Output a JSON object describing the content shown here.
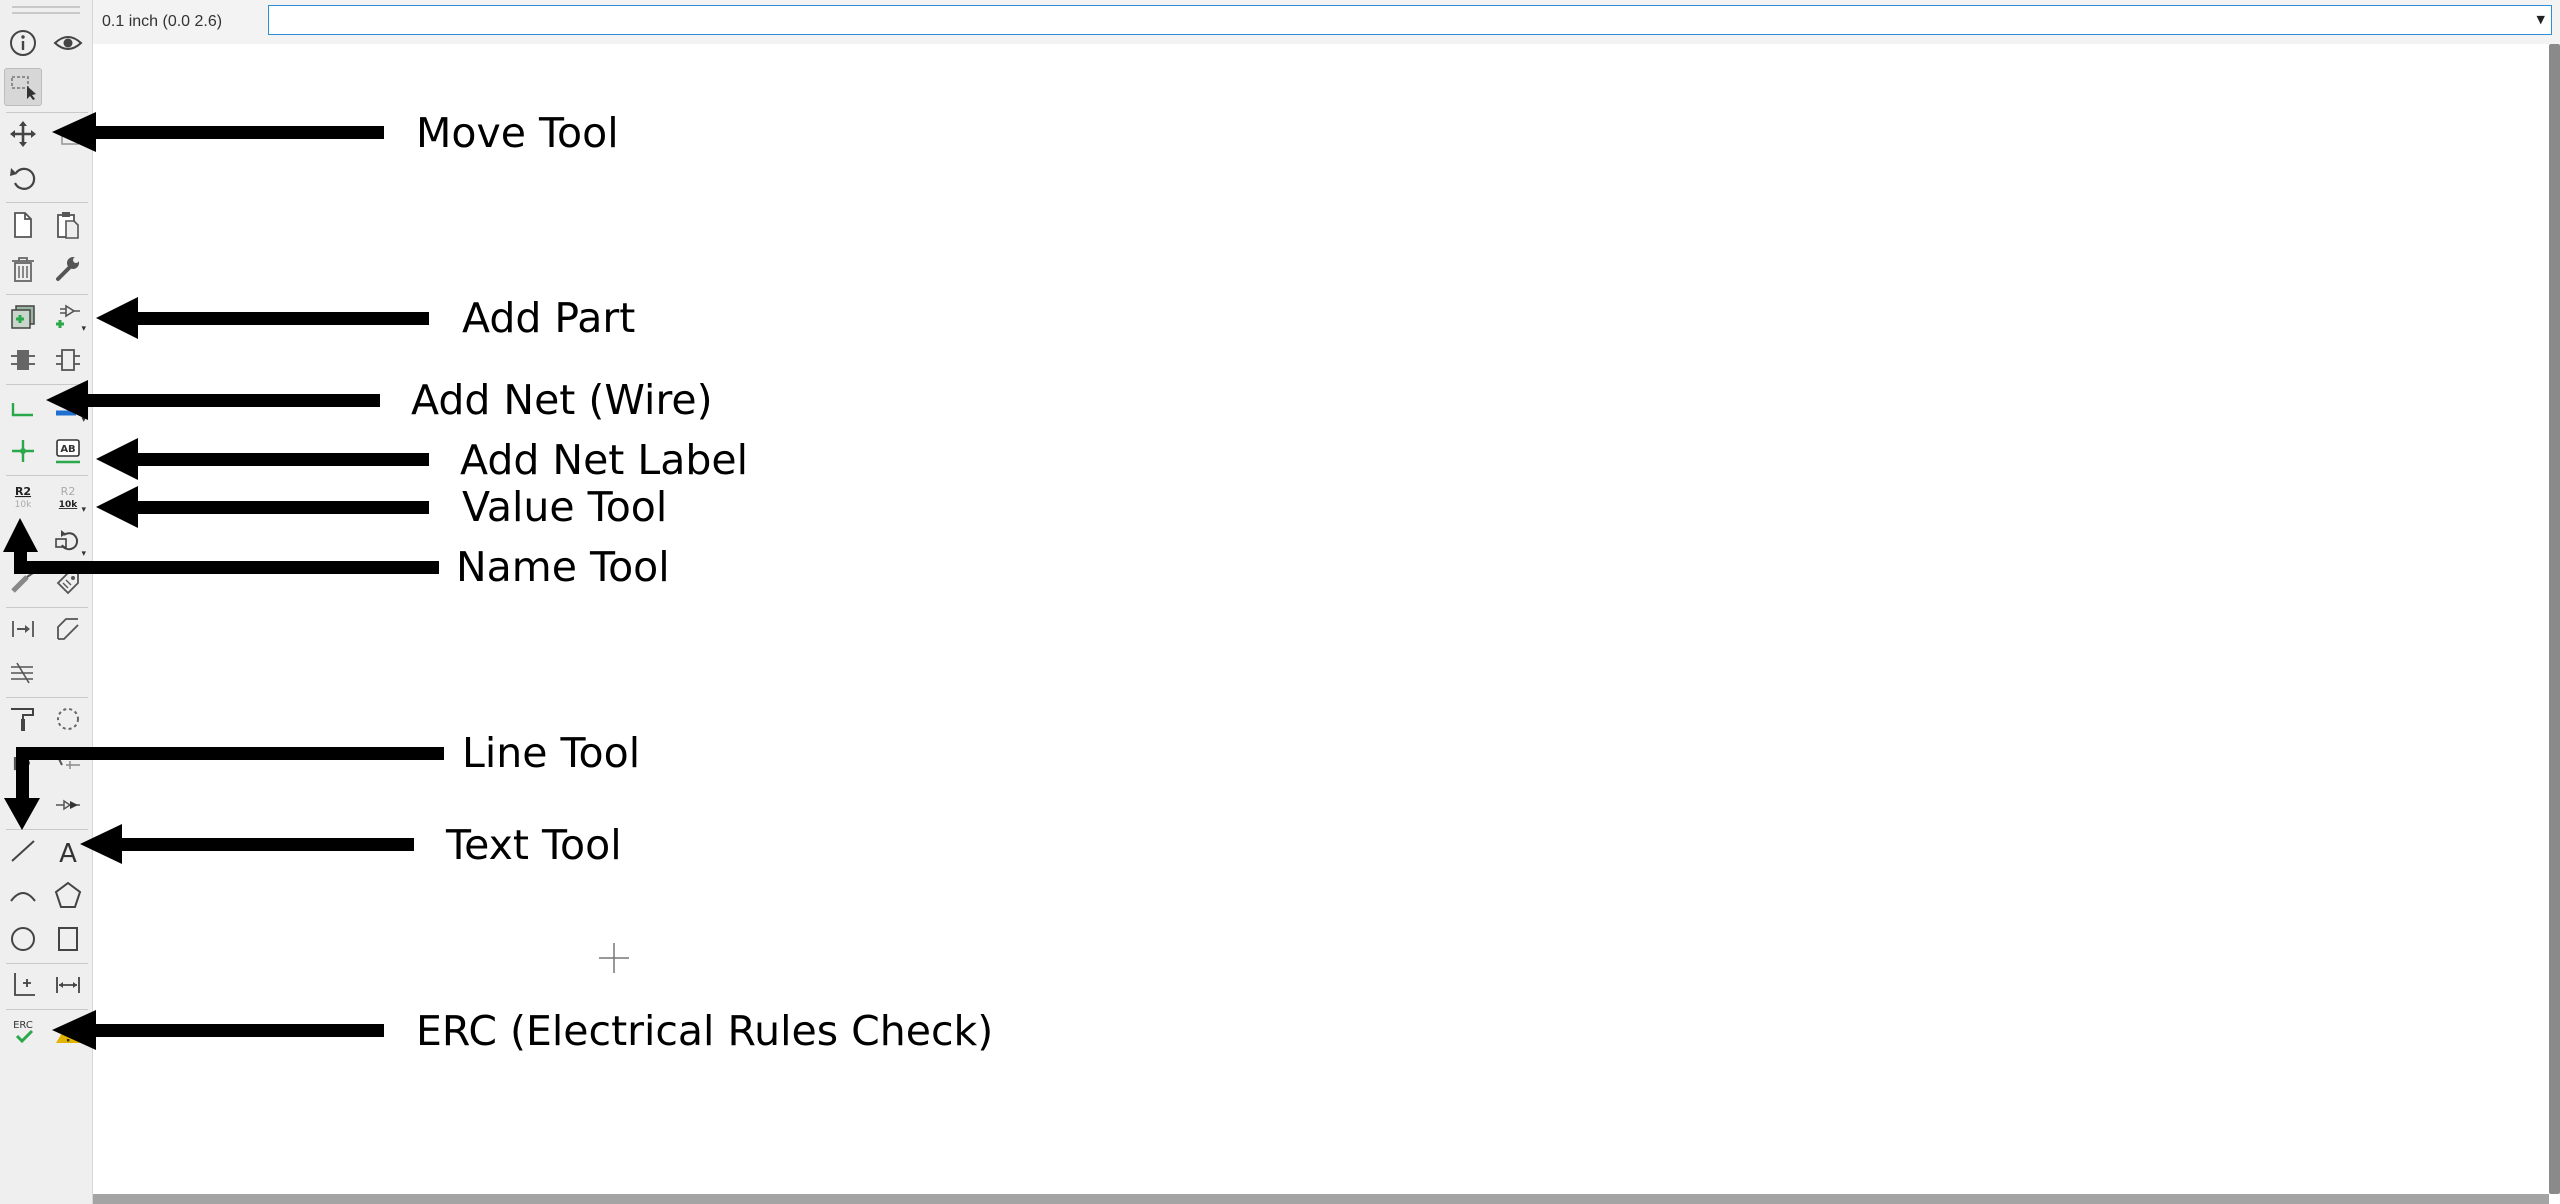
{
  "topbar": {
    "grid_label": "0.1 inch (0.0 2.6)",
    "command_value": ""
  },
  "toolbar": {
    "tools": [
      {
        "name": "info-icon"
      },
      {
        "name": "eye-icon"
      },
      {
        "name": "select-icon"
      },
      {
        "name": "move-icon"
      },
      {
        "name": "copy-group-icon"
      },
      {
        "name": "rotate-icon"
      },
      {
        "name": "copy-icon"
      },
      {
        "name": "paste-icon"
      },
      {
        "name": "delete-icon"
      },
      {
        "name": "wrench-icon"
      },
      {
        "name": "add-part-icon"
      },
      {
        "name": "add-symbol-icon"
      },
      {
        "name": "pinswap-icon"
      },
      {
        "name": "gate-icon"
      },
      {
        "name": "wire-icon"
      },
      {
        "name": "bus-icon"
      },
      {
        "name": "junction-icon"
      },
      {
        "name": "net-label-icon"
      },
      {
        "name": "name-icon"
      },
      {
        "name": "value-icon"
      },
      {
        "name": "smash-icon"
      },
      {
        "name": "mirror-icon"
      },
      {
        "name": "split-icon"
      },
      {
        "name": "attribute-icon"
      },
      {
        "name": "invoke-icon"
      },
      {
        "name": "miter-icon"
      },
      {
        "name": "optimize-icon"
      },
      {
        "name": "paint-icon"
      },
      {
        "name": "group-icon"
      },
      {
        "name": "route-icon"
      },
      {
        "name": "ripup-icon"
      },
      {
        "name": "line-icon"
      },
      {
        "name": "text-icon"
      },
      {
        "name": "arc-icon"
      },
      {
        "name": "polygon-icon"
      },
      {
        "name": "circle-icon"
      },
      {
        "name": "rectangle-icon"
      },
      {
        "name": "dimension-icon"
      },
      {
        "name": "measure-icon"
      },
      {
        "name": "erc-icon"
      },
      {
        "name": "warning-icon"
      }
    ],
    "erc_text": "ERC",
    "name_text": "R2",
    "name_sub": "10k",
    "value_text": "R2",
    "value_sub": "10k",
    "net_label_text": "AB",
    "text_glyph": "A"
  },
  "annotations": [
    {
      "id": "move",
      "text": "Move Tool"
    },
    {
      "id": "add_part",
      "text": "Add Part"
    },
    {
      "id": "add_net",
      "text": "Add Net (Wire)"
    },
    {
      "id": "add_net_label",
      "text": "Add Net Label"
    },
    {
      "id": "value",
      "text": "Value Tool"
    },
    {
      "id": "name",
      "text": "Name Tool"
    },
    {
      "id": "line",
      "text": "Line Tool"
    },
    {
      "id": "text",
      "text": "Text Tool"
    },
    {
      "id": "erc",
      "text": "ERC (Electrical Rules Check)"
    }
  ],
  "colors": {
    "accent": "#2f8fd6",
    "green": "#2aa84a",
    "blue": "#1f6fd0",
    "yellow": "#e2b400",
    "arrow": "#000000"
  }
}
